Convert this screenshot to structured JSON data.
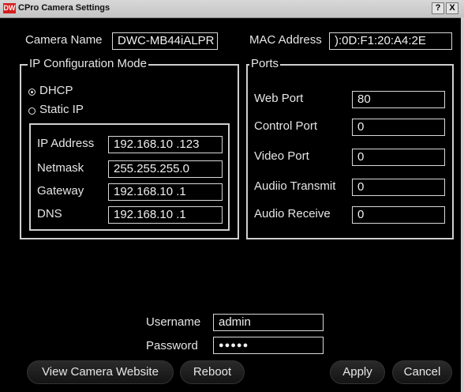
{
  "window": {
    "icon_text": "DW",
    "title": "CPro Camera Settings",
    "help_label": "?",
    "close_label": "X"
  },
  "camera": {
    "name_label": "Camera Name",
    "name_value": "DWC-MB44iALPR",
    "mac_label": "MAC Address",
    "mac_value": "):0D:F1:20:A4:2E"
  },
  "ip_config": {
    "legend": "IP Configuration Mode",
    "dhcp_label": "DHCP",
    "static_label": "Static IP",
    "selected": "DHCP",
    "fields": [
      {
        "label": "IP Address",
        "value": "192.168.10 .123"
      },
      {
        "label": "Netmask",
        "value": "255.255.255.0"
      },
      {
        "label": "Gateway",
        "value": "192.168.10 .1"
      },
      {
        "label": "DNS",
        "value": "192.168.10 .1"
      }
    ]
  },
  "ports": {
    "legend": "Ports",
    "fields": [
      {
        "label": "Web Port",
        "value": "80"
      },
      {
        "label": "Control Port",
        "value": "0"
      },
      {
        "label": "Video Port",
        "value": "0"
      },
      {
        "label": "Audiio Transmit",
        "value": "0"
      },
      {
        "label": "Audio Receive",
        "value": "0"
      }
    ]
  },
  "login": {
    "username_label": "Username",
    "username_value": "admin",
    "password_label": "Password",
    "password_value": "●●●●●"
  },
  "buttons": {
    "view_website": "View Camera Website",
    "reboot": "Reboot",
    "apply": "Apply",
    "cancel": "Cancel"
  }
}
